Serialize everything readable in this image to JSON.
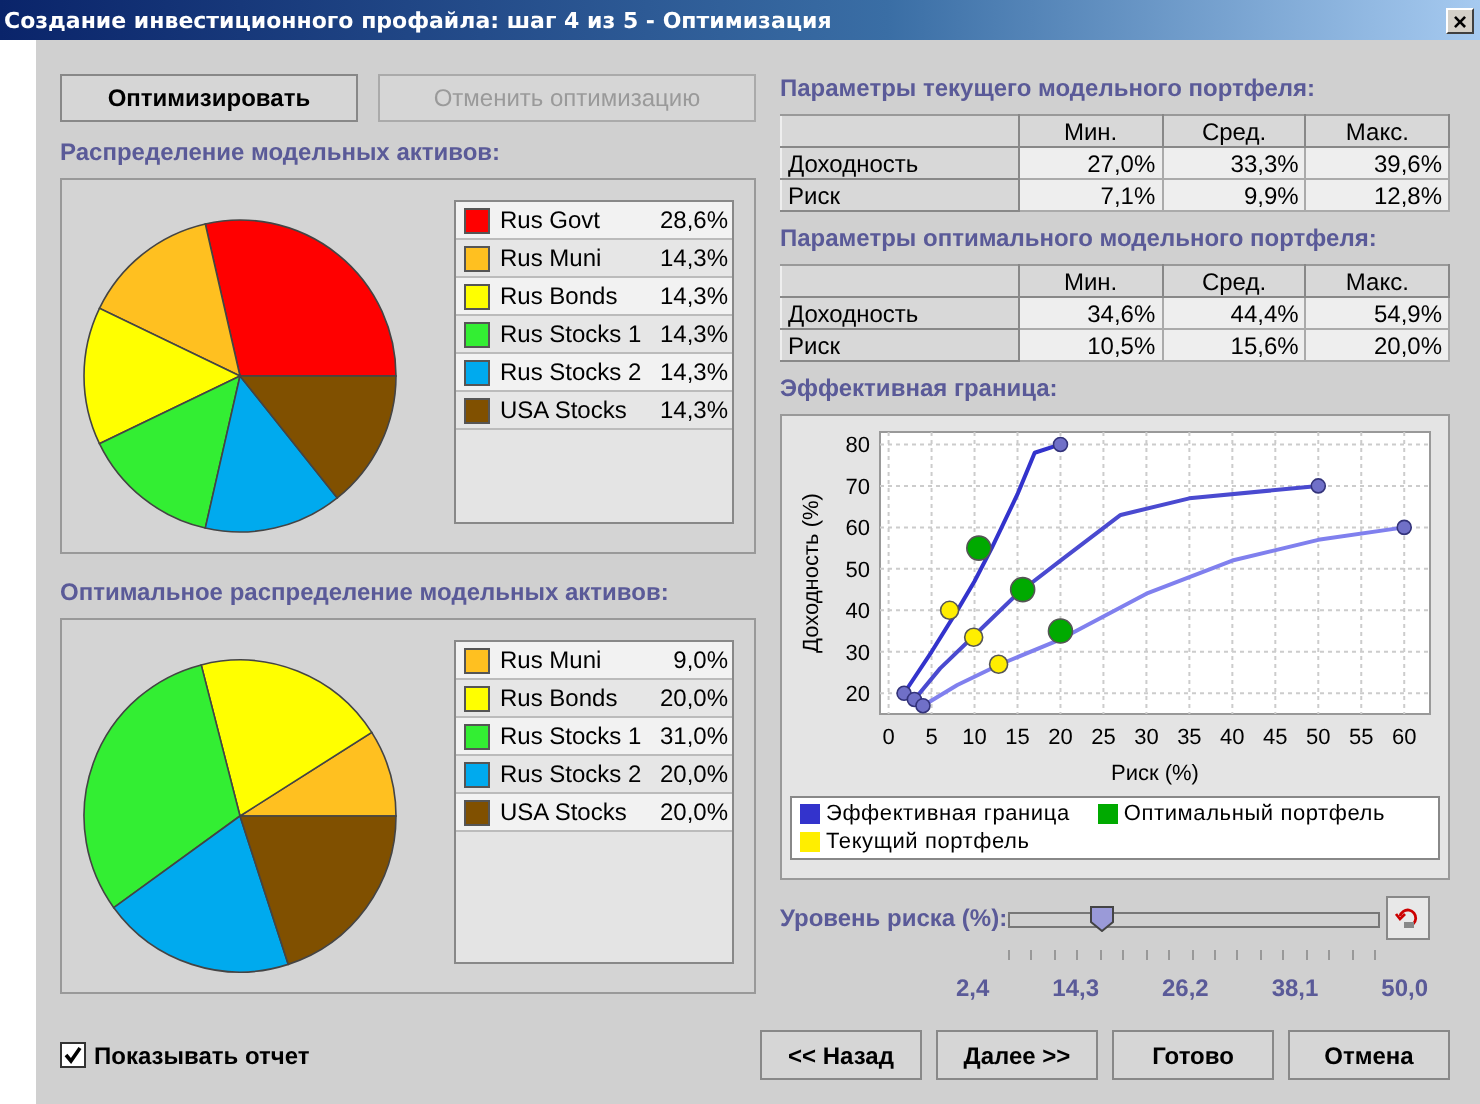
{
  "window": {
    "title": "Создание инвестиционного профайла: шаг 4 из 5 - Оптимизация",
    "close": "×"
  },
  "top_buttons": [
    {
      "label": "Оптимизировать",
      "disabled": false
    },
    {
      "label": "Отменить оптимизацию",
      "disabled": true
    }
  ],
  "allocation": {
    "title": "Распределение модельных активов:",
    "chart_data": {
      "type": "pie",
      "categories": [
        "Rus Govt",
        "Rus Muni",
        "Rus Bonds",
        "Rus Stocks 1",
        "Rus Stocks 2",
        "USA Stocks"
      ],
      "values": [
        28.6,
        14.3,
        14.3,
        14.3,
        14.3,
        14.3
      ],
      "colors": [
        "#ff0000",
        "#ffc020",
        "#ffff00",
        "#33ee33",
        "#00aaee",
        "#805000"
      ],
      "value_labels": [
        "28,6%",
        "14,3%",
        "14,3%",
        "14,3%",
        "14,3%",
        "14,3%"
      ]
    }
  },
  "optimal_allocation": {
    "title": "Оптимальное распределение модельных активов:",
    "chart_data": {
      "type": "pie",
      "categories": [
        "Rus Muni",
        "Rus Bonds",
        "Rus Stocks 1",
        "Rus Stocks 2",
        "USA Stocks"
      ],
      "values": [
        9.0,
        20.0,
        31.0,
        20.0,
        20.0
      ],
      "colors": [
        "#ffc020",
        "#ffff00",
        "#33ee33",
        "#00aaee",
        "#805000"
      ],
      "value_labels": [
        "9,0%",
        "20,0%",
        "31,0%",
        "20,0%",
        "20,0%"
      ]
    }
  },
  "current_params": {
    "title": "Параметры текущего модельного портфеля:",
    "columns": [
      "Мин.",
      "Сред.",
      "Макс."
    ],
    "rows": [
      {
        "label": "Доходность",
        "cells": [
          "27,0%",
          "33,3%",
          "39,6%"
        ]
      },
      {
        "label": "Риск",
        "cells": [
          "7,1%",
          "9,9%",
          "12,8%"
        ]
      }
    ]
  },
  "optimal_params": {
    "title": "Параметры оптимального модельного портфеля:",
    "columns": [
      "Мин.",
      "Сред.",
      "Макс."
    ],
    "rows": [
      {
        "label": "Доходность",
        "cells": [
          "34,6%",
          "44,4%",
          "54,9%"
        ]
      },
      {
        "label": "Риск",
        "cells": [
          "10,5%",
          "15,6%",
          "20,0%"
        ]
      }
    ]
  },
  "frontier": {
    "title": "Эффективная граница:",
    "chart_data": {
      "type": "line",
      "xlabel": "Риск (%)",
      "ylabel": "Доходность (%)",
      "xlim": [
        -1,
        63
      ],
      "ylim": [
        15,
        83
      ],
      "xticks": [
        0,
        5,
        10,
        15,
        20,
        25,
        30,
        35,
        40,
        45,
        50,
        55,
        60
      ],
      "yticks": [
        20,
        30,
        40,
        50,
        60,
        70,
        80
      ],
      "grid": true,
      "series": [
        {
          "name": "Эффективная граница",
          "color": "#3333cc",
          "type": "line",
          "x": [
            1.8,
            5,
            8,
            10,
            12,
            15,
            17,
            20
          ],
          "values": [
            20,
            30,
            40,
            47,
            55,
            68,
            78,
            80
          ]
        },
        {
          "color": "#4a4ad0",
          "type": "line",
          "x": [
            3,
            6,
            10,
            15,
            20,
            27,
            35,
            50
          ],
          "values": [
            18.5,
            26,
            34,
            44,
            52,
            63,
            67,
            70
          ]
        },
        {
          "color": "#8080ee",
          "type": "line",
          "x": [
            4,
            8,
            13,
            20,
            30,
            40,
            50,
            60
          ],
          "values": [
            17,
            22,
            27,
            33,
            44,
            52,
            57,
            60
          ]
        },
        {
          "name": "Оптимальный портфель",
          "color": "#00aa00",
          "type": "scatter",
          "x": [
            10.5,
            15.6,
            20
          ],
          "values": [
            55,
            45,
            35
          ]
        },
        {
          "name": "Текущий портфель",
          "color": "#ffee00",
          "type": "scatter",
          "x": [
            7.1,
            9.9,
            12.8
          ],
          "values": [
            40,
            33.5,
            27
          ]
        }
      ]
    }
  },
  "risk_level": {
    "label": "Уровень риска (%):",
    "level": 0.25,
    "ticks": [
      "2,4",
      "14,3",
      "26,2",
      "38,1",
      "50,0"
    ]
  },
  "show_report": {
    "label": "Показывать отчет",
    "checked": true
  },
  "nav_buttons": [
    "<< Назад",
    "Далее >>",
    "Готово",
    "Отмена"
  ]
}
